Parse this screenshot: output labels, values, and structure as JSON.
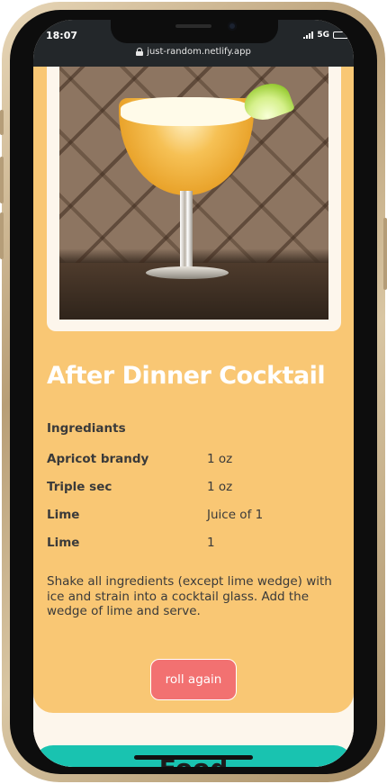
{
  "status_bar": {
    "time": "18:07",
    "network": "5G",
    "url": "just-random.netlify.app"
  },
  "recipe": {
    "image_alt": "After Dinner Cocktail photo",
    "title": "After Dinner Cocktail",
    "ingredients_heading": "Ingrediants",
    "ingredients": [
      {
        "name": "Apricot brandy",
        "measure": "1 oz"
      },
      {
        "name": "Triple sec",
        "measure": "1 oz"
      },
      {
        "name": "Lime",
        "measure": "Juice of 1"
      },
      {
        "name": "Lime",
        "measure": "1"
      }
    ],
    "instructions": "Shake all ingredients (except lime wedge) with ice and strain into a cocktail glass. Add the wedge of lime and serve.",
    "roll_button": "roll again"
  },
  "next_section": {
    "title": "Food"
  },
  "colors": {
    "card": "#f9c774",
    "button": "#f27171",
    "food_card": "#19c3b0",
    "page_bg": "#fdf6ec"
  }
}
